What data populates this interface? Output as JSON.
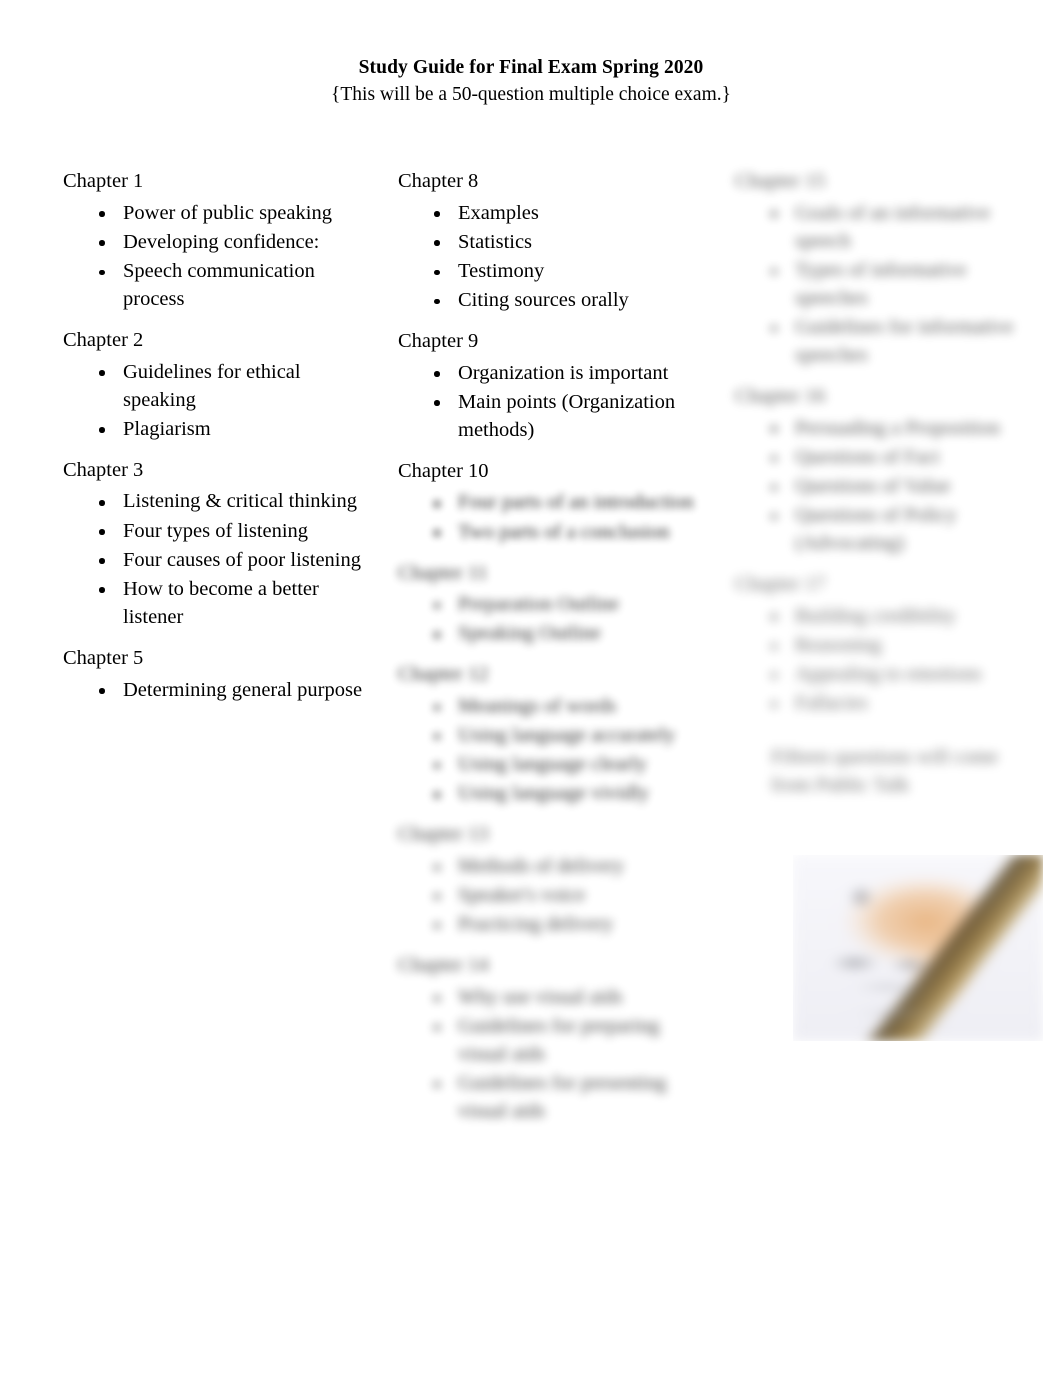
{
  "document": {
    "title": "Study Guide for Final Exam Spring 2020",
    "subtitle": "{This will be a 50-question multiple choice exam.}"
  },
  "columns": [
    {
      "id": "column-1",
      "chapters": [
        {
          "heading": "Chapter 1",
          "blur": 0,
          "items": [
            "Power of public speaking",
            "Developing confidence:",
            "Speech communication process"
          ]
        },
        {
          "heading": "Chapter 2",
          "blur": 0,
          "items": [
            "Guidelines for ethical speaking",
            "Plagiarism"
          ]
        },
        {
          "heading": "Chapter 3",
          "blur": 0,
          "items": [
            "Listening & critical thinking",
            "Four types of listening",
            "Four causes of poor listening",
            "How to become a better listener"
          ]
        },
        {
          "heading": "Chapter 5",
          "blur": 0,
          "items": [
            "Determining general purpose"
          ]
        }
      ]
    },
    {
      "id": "column-2",
      "chapters": [
        {
          "heading": "Chapter 8",
          "blur": 0,
          "items": [
            "Examples",
            "Statistics",
            "Testimony",
            "Citing sources orally"
          ]
        },
        {
          "heading": "Chapter 9",
          "blur": 0,
          "items": [
            "Organization is important",
            "Main points (Organization methods)"
          ]
        },
        {
          "heading": "Chapter 10",
          "heading_blur": 0,
          "blur": 3,
          "items": [
            "Four parts of an introduction",
            "Two parts of a conclusion"
          ]
        },
        {
          "heading": "Chapter 11",
          "blur": 4,
          "items": [
            "Preparation Outline",
            "Speaking Outline"
          ]
        },
        {
          "heading": "Chapter 12",
          "blur": 4,
          "items": [
            "Meanings of words",
            "Using language accurately",
            "Using language clearly",
            "Using language vividly"
          ]
        },
        {
          "heading": "Chapter 13",
          "blur": 5,
          "items": [
            "Methods of delivery",
            "Speaker's voice",
            "Practicing delivery"
          ]
        },
        {
          "heading": "Chapter 14",
          "blur": 5,
          "items": [
            "Why use visual aids",
            "Guidelines for preparing visual aids",
            "Guidelines for presenting visual aids"
          ]
        }
      ]
    },
    {
      "id": "column-3",
      "chapters": [
        {
          "heading": "Chapter 15",
          "blur": 6,
          "items": [
            "Goals of an informative speech",
            "Types of informative speeches",
            "Guidelines for informative speeches"
          ]
        },
        {
          "heading": "Chapter 16",
          "blur": 6,
          "items": [
            "Persuading a Proposition",
            "Questions of Fact",
            "Questions of Value",
            "Questions of Policy (Advocating)"
          ]
        },
        {
          "heading": "Chapter 17",
          "blur": 7,
          "items": [
            "Building credibility",
            "Reasoning",
            "Appealing to emotions",
            "Fallacies"
          ]
        }
      ],
      "note": "Fifteen questions will come from Public Talk",
      "note_blur": 7
    }
  ],
  "photo": {
    "alt": "Hand writing on paper with a pen",
    "blur": 7
  }
}
